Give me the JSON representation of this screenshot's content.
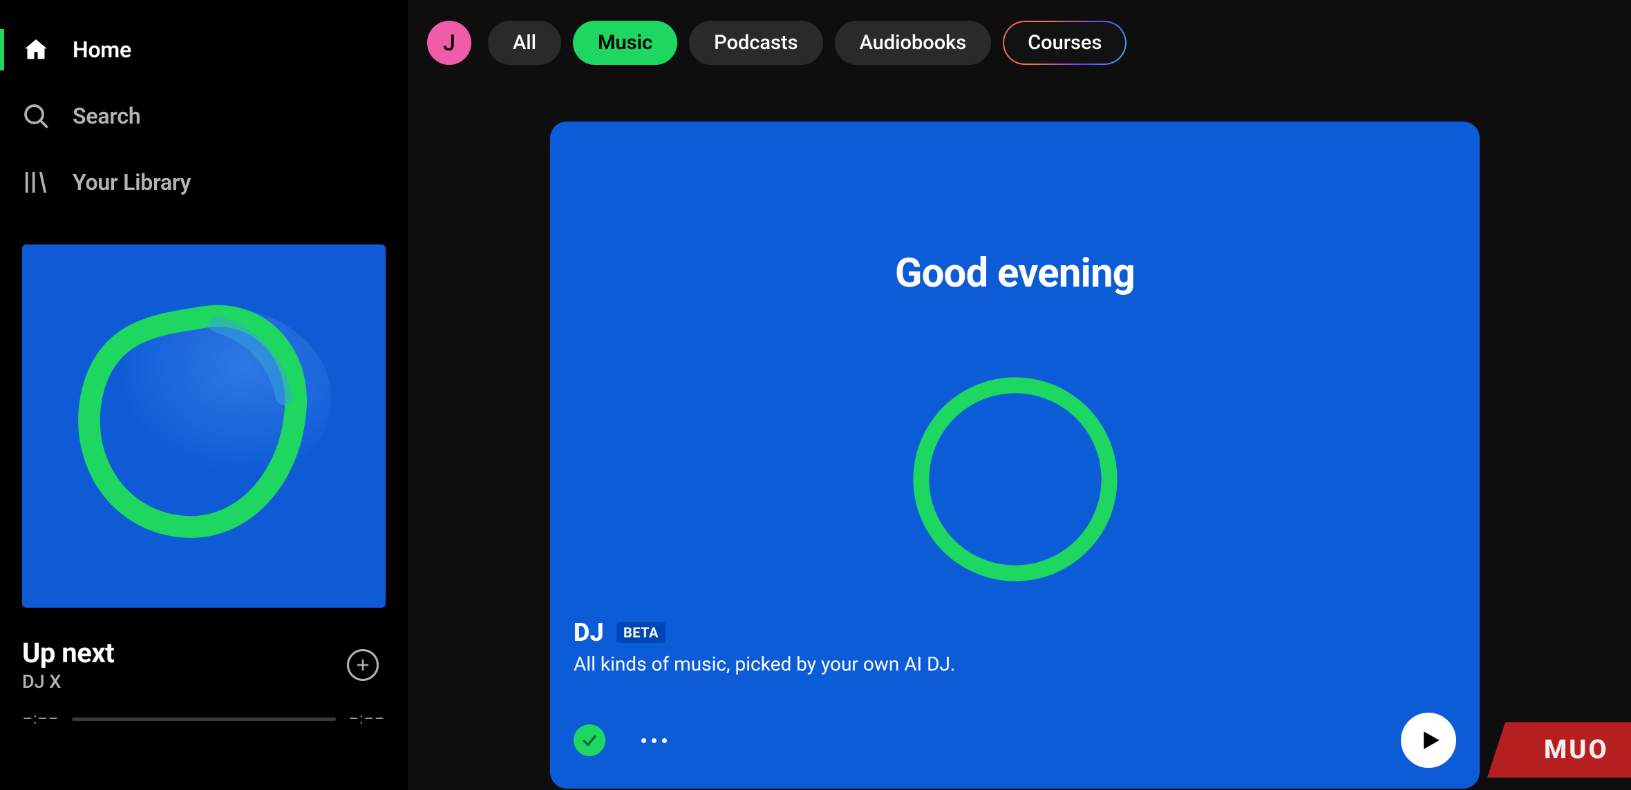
{
  "sidebar": {
    "nav": [
      {
        "label": "Home",
        "icon": "home-icon",
        "active": true
      },
      {
        "label": "Search",
        "icon": "search-icon",
        "active": false
      },
      {
        "label": "Your Library",
        "icon": "library-icon",
        "active": false
      }
    ],
    "now_playing": {
      "title": "Up next",
      "subtitle": "DJ X",
      "time_elapsed": "–:––",
      "time_total": "–:––"
    }
  },
  "header": {
    "avatar_initial": "J",
    "chips": [
      {
        "label": "All",
        "style": "default"
      },
      {
        "label": "Music",
        "style": "active"
      },
      {
        "label": "Podcasts",
        "style": "default"
      },
      {
        "label": "Audiobooks",
        "style": "default"
      },
      {
        "label": "Courses",
        "style": "outlined"
      }
    ]
  },
  "card": {
    "greeting": "Good evening",
    "title": "DJ",
    "badge": "BETA",
    "description": "All kinds of music, picked by your own AI DJ."
  },
  "watermark": "MUO",
  "colors": {
    "accent": "#1ed760",
    "card_bg": "#0d5cd7",
    "avatar_bg": "#ef5da8"
  }
}
